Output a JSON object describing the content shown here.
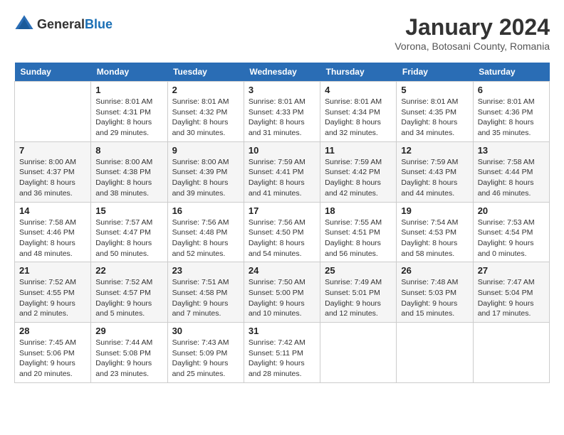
{
  "header": {
    "logo": {
      "general": "General",
      "blue": "Blue"
    },
    "title": "January 2024",
    "subtitle": "Vorona, Botosani County, Romania"
  },
  "calendar": {
    "days_of_week": [
      "Sunday",
      "Monday",
      "Tuesday",
      "Wednesday",
      "Thursday",
      "Friday",
      "Saturday"
    ],
    "weeks": [
      [
        {
          "day": "",
          "info": ""
        },
        {
          "day": "1",
          "info": "Sunrise: 8:01 AM\nSunset: 4:31 PM\nDaylight: 8 hours\nand 29 minutes."
        },
        {
          "day": "2",
          "info": "Sunrise: 8:01 AM\nSunset: 4:32 PM\nDaylight: 8 hours\nand 30 minutes."
        },
        {
          "day": "3",
          "info": "Sunrise: 8:01 AM\nSunset: 4:33 PM\nDaylight: 8 hours\nand 31 minutes."
        },
        {
          "day": "4",
          "info": "Sunrise: 8:01 AM\nSunset: 4:34 PM\nDaylight: 8 hours\nand 32 minutes."
        },
        {
          "day": "5",
          "info": "Sunrise: 8:01 AM\nSunset: 4:35 PM\nDaylight: 8 hours\nand 34 minutes."
        },
        {
          "day": "6",
          "info": "Sunrise: 8:01 AM\nSunset: 4:36 PM\nDaylight: 8 hours\nand 35 minutes."
        }
      ],
      [
        {
          "day": "7",
          "info": "Sunrise: 8:00 AM\nSunset: 4:37 PM\nDaylight: 8 hours\nand 36 minutes."
        },
        {
          "day": "8",
          "info": "Sunrise: 8:00 AM\nSunset: 4:38 PM\nDaylight: 8 hours\nand 38 minutes."
        },
        {
          "day": "9",
          "info": "Sunrise: 8:00 AM\nSunset: 4:39 PM\nDaylight: 8 hours\nand 39 minutes."
        },
        {
          "day": "10",
          "info": "Sunrise: 7:59 AM\nSunset: 4:41 PM\nDaylight: 8 hours\nand 41 minutes."
        },
        {
          "day": "11",
          "info": "Sunrise: 7:59 AM\nSunset: 4:42 PM\nDaylight: 8 hours\nand 42 minutes."
        },
        {
          "day": "12",
          "info": "Sunrise: 7:59 AM\nSunset: 4:43 PM\nDaylight: 8 hours\nand 44 minutes."
        },
        {
          "day": "13",
          "info": "Sunrise: 7:58 AM\nSunset: 4:44 PM\nDaylight: 8 hours\nand 46 minutes."
        }
      ],
      [
        {
          "day": "14",
          "info": "Sunrise: 7:58 AM\nSunset: 4:46 PM\nDaylight: 8 hours\nand 48 minutes."
        },
        {
          "day": "15",
          "info": "Sunrise: 7:57 AM\nSunset: 4:47 PM\nDaylight: 8 hours\nand 50 minutes."
        },
        {
          "day": "16",
          "info": "Sunrise: 7:56 AM\nSunset: 4:48 PM\nDaylight: 8 hours\nand 52 minutes."
        },
        {
          "day": "17",
          "info": "Sunrise: 7:56 AM\nSunset: 4:50 PM\nDaylight: 8 hours\nand 54 minutes."
        },
        {
          "day": "18",
          "info": "Sunrise: 7:55 AM\nSunset: 4:51 PM\nDaylight: 8 hours\nand 56 minutes."
        },
        {
          "day": "19",
          "info": "Sunrise: 7:54 AM\nSunset: 4:53 PM\nDaylight: 8 hours\nand 58 minutes."
        },
        {
          "day": "20",
          "info": "Sunrise: 7:53 AM\nSunset: 4:54 PM\nDaylight: 9 hours\nand 0 minutes."
        }
      ],
      [
        {
          "day": "21",
          "info": "Sunrise: 7:52 AM\nSunset: 4:55 PM\nDaylight: 9 hours\nand 2 minutes."
        },
        {
          "day": "22",
          "info": "Sunrise: 7:52 AM\nSunset: 4:57 PM\nDaylight: 9 hours\nand 5 minutes."
        },
        {
          "day": "23",
          "info": "Sunrise: 7:51 AM\nSunset: 4:58 PM\nDaylight: 9 hours\nand 7 minutes."
        },
        {
          "day": "24",
          "info": "Sunrise: 7:50 AM\nSunset: 5:00 PM\nDaylight: 9 hours\nand 10 minutes."
        },
        {
          "day": "25",
          "info": "Sunrise: 7:49 AM\nSunset: 5:01 PM\nDaylight: 9 hours\nand 12 minutes."
        },
        {
          "day": "26",
          "info": "Sunrise: 7:48 AM\nSunset: 5:03 PM\nDaylight: 9 hours\nand 15 minutes."
        },
        {
          "day": "27",
          "info": "Sunrise: 7:47 AM\nSunset: 5:04 PM\nDaylight: 9 hours\nand 17 minutes."
        }
      ],
      [
        {
          "day": "28",
          "info": "Sunrise: 7:45 AM\nSunset: 5:06 PM\nDaylight: 9 hours\nand 20 minutes."
        },
        {
          "day": "29",
          "info": "Sunrise: 7:44 AM\nSunset: 5:08 PM\nDaylight: 9 hours\nand 23 minutes."
        },
        {
          "day": "30",
          "info": "Sunrise: 7:43 AM\nSunset: 5:09 PM\nDaylight: 9 hours\nand 25 minutes."
        },
        {
          "day": "31",
          "info": "Sunrise: 7:42 AM\nSunset: 5:11 PM\nDaylight: 9 hours\nand 28 minutes."
        },
        {
          "day": "",
          "info": ""
        },
        {
          "day": "",
          "info": ""
        },
        {
          "day": "",
          "info": ""
        }
      ]
    ]
  }
}
